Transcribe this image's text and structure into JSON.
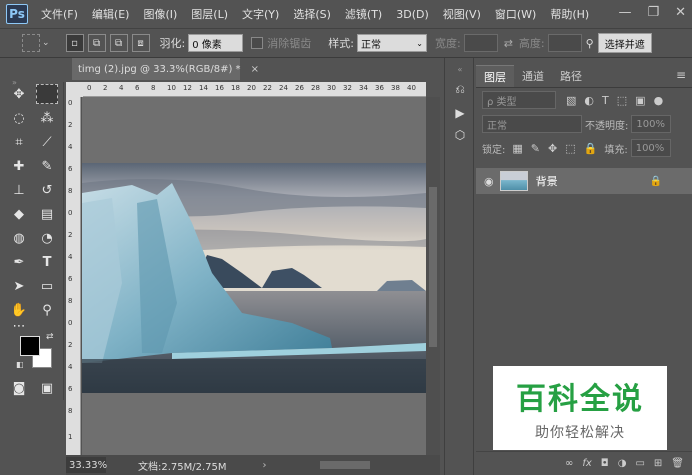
{
  "app": {
    "logo": "Ps"
  },
  "menu": [
    "文件(F)",
    "编辑(E)",
    "图像(I)",
    "图层(L)",
    "文字(Y)",
    "选择(S)",
    "滤镜(T)",
    "3D(D)",
    "视图(V)",
    "窗口(W)",
    "帮助(H)"
  ],
  "window_controls": {
    "minimize": "—",
    "restore": "❐",
    "close": "✕"
  },
  "options": {
    "feather_label": "羽化:",
    "feather_value": "0 像素",
    "antialias_label": "消除锯齿",
    "style_label": "样式:",
    "style_value": "正常",
    "width_label": "宽度:",
    "height_label": "高度:",
    "select_mask_button": "选择并遮"
  },
  "document": {
    "tab_title": "timg (2).jpg @ 33.3%(RGB/8#) *",
    "close_icon": "×",
    "zoom": "33.33%",
    "doc_info": "文档:2.75M/2.75M",
    "ruler_h": [
      "0",
      "2",
      "4",
      "6",
      "8",
      "10",
      "12",
      "14",
      "16",
      "18",
      "20",
      "22",
      "24",
      "26",
      "28",
      "30",
      "32",
      "34",
      "36",
      "38",
      "40"
    ],
    "ruler_v": [
      "0",
      "2",
      "4",
      "6",
      "8",
      "0",
      "2",
      "4",
      "6",
      "8",
      "0",
      "2",
      "4",
      "6",
      "8",
      "1"
    ]
  },
  "panel": {
    "tabs": [
      "图层",
      "通道",
      "路径"
    ],
    "kind_filter": "ρ 类型",
    "blend_mode": "正常",
    "opacity_label": "不透明度:",
    "opacity_value": "100%",
    "lock_label": "锁定:",
    "fill_label": "填充:",
    "fill_value": "100%",
    "layers": [
      {
        "name": "背景",
        "locked": true,
        "visible": true
      }
    ]
  },
  "watermark": {
    "title": "百科全说",
    "subtitle": "助你轻松解决"
  },
  "colors": {
    "accent": "#26a043",
    "ui_bg": "#535353",
    "canvas_bg": "#6f6f6f"
  }
}
